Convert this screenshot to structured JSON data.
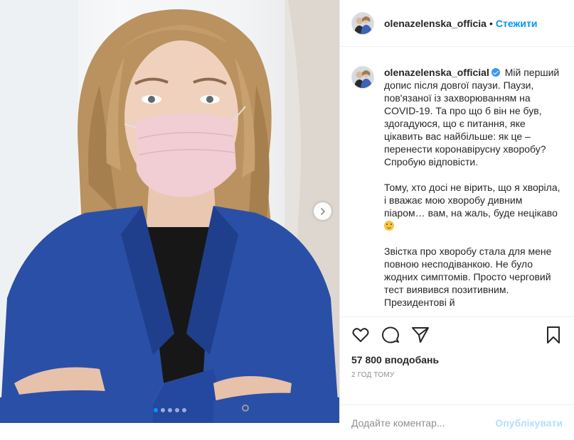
{
  "media": {
    "carousel": {
      "slide_count": 5,
      "active_index": 0
    },
    "next_icon": "chevron-right-icon"
  },
  "header": {
    "username": "olenazelenska_officia",
    "separator": "•",
    "follow_label": "Стежити"
  },
  "caption": {
    "username": "olenazelenska_official",
    "verified_icon": "verified-badge-icon",
    "paragraphs": [
      "Мій перший допис після довгої паузи. Паузи, пов'язаної із захворюванням на COVID-19. Та про що б він не був, здогадуюся, що є питання, яке цікавить вас найбільше: як це – перенести коронавірусну хворобу? Спробую відповісти.",
      "Тому, хто досі не вірить, що я хворіла, і вважає мою хворобу дивним піаром… вам, на жаль, буде нецікаво",
      "Звістка про хворобу стала для мене повною несподіванкою. Не було жодних симптомів. Просто черговий тест виявився позитивним. Президентові й"
    ],
    "emoji": "winking-face-emoji"
  },
  "actions": {
    "like_icon": "heart-icon",
    "comment_icon": "comment-icon",
    "share_icon": "share-icon",
    "save_icon": "bookmark-icon"
  },
  "likes_text": "57 800 вподобань",
  "time_text": "2 год тому",
  "comment": {
    "placeholder": "Додайте коментар...",
    "publish_label": "Опублікувати"
  },
  "colors": {
    "accent": "#0095f6",
    "publish_disabled": "#b2dffc",
    "verified": "#3897f0",
    "blazer": "#2a4fa6"
  }
}
